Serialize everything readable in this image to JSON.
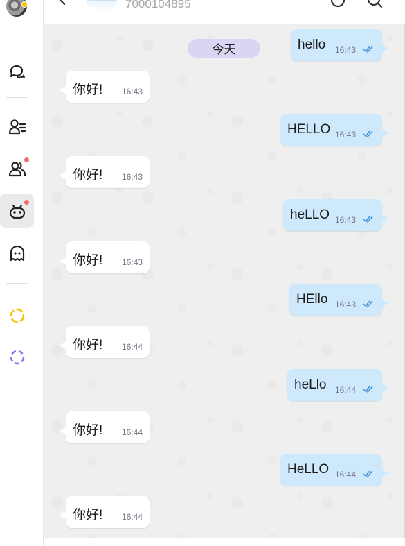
{
  "header": {
    "contact_number": "7000104895"
  },
  "rail": {
    "items": [
      {
        "name": "chats-icon"
      },
      {
        "name": "contacts-icon"
      },
      {
        "name": "groups-icon"
      },
      {
        "name": "bot-icon"
      },
      {
        "name": "ghost-icon"
      },
      {
        "name": "status-yellow-icon"
      },
      {
        "name": "status-purple-icon"
      }
    ]
  },
  "chat": {
    "date_label": "今天",
    "messages": [
      {
        "direction": "out",
        "text": "hello",
        "time": "16:43"
      },
      {
        "direction": "in",
        "text": "你好!",
        "time": "16:43"
      },
      {
        "direction": "out",
        "text": "HELLO",
        "time": "16:43"
      },
      {
        "direction": "in",
        "text": "你好!",
        "time": "16:43"
      },
      {
        "direction": "out",
        "text": "heLLO",
        "time": "16:43"
      },
      {
        "direction": "in",
        "text": "你好!",
        "time": "16:43"
      },
      {
        "direction": "out",
        "text": "HEllo",
        "time": "16:43"
      },
      {
        "direction": "in",
        "text": "你好!",
        "time": "16:44"
      },
      {
        "direction": "out",
        "text": "heLlo",
        "time": "16:44"
      },
      {
        "direction": "in",
        "text": "你好!",
        "time": "16:44"
      },
      {
        "direction": "out",
        "text": "HeLLO",
        "time": "16:44"
      },
      {
        "direction": "in",
        "text": "你好!",
        "time": "16:44"
      }
    ]
  },
  "colors": {
    "incoming_bubble": "#ffffff",
    "outgoing_bubble": "#cfe9fc",
    "read_check": "#3b8fd6",
    "date_pill": "#d8d6f2",
    "notification_dot": "#f16a6a",
    "status_yellow": "#f2c400",
    "status_purple": "#8c78e8"
  }
}
